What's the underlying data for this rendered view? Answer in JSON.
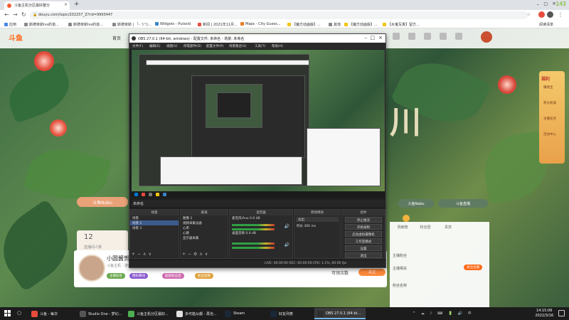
{
  "browser": {
    "tab_title": "斗鱼主机分区最好整分",
    "fps_overlay": "143",
    "url": "douyu.com/topic/202257_Z?rid=9993447",
    "bookmarks": [
      "应用",
      "斯德亲斯lvs的道...",
      "斯德亲斯lvs的道...",
      "斯德亲斯 | 「- ツつ...",
      "Widgets - Pulsoid",
      "新闻 | 2021年11月...",
      "Maps - City Guess...",
      "【魔方动画版】...",
      "其他",
      "【魔方动画版】...",
      "【水鬼写真】留方..."
    ],
    "reading_list": "阅读清单"
  },
  "douyu": {
    "logo": "斗鱼",
    "home": "首页",
    "big_title": "川",
    "left_button": "斗鱼Nabu",
    "stat_num": "12",
    "stat_label": "直播间人数",
    "streamer": {
      "name": "小圆酱贺",
      "meta": "斗鱼主机 · 游戏主播",
      "pills": [
        "主播标签",
        "精彩瞬间",
        "超级粉丝团",
        "粉丝勋章"
      ],
      "follow_count": "可领次数",
      "follow_btn": "关注"
    },
    "right_pills": [
      "斗鱼Nabu",
      "斗鱼直播"
    ],
    "right_sidebar": {
      "tabs": [
        "贡献榜",
        "粉丝团",
        "贵宾"
      ],
      "rows": [
        "主播粉丝",
        "主播相关"
      ],
      "badges": [
        "关注主播"
      ],
      "list_item": "粉丝名称"
    },
    "promo": {
      "title": "福利",
      "items": [
        "赚钱宝",
        "积分商城",
        "主播任务",
        "活动中心"
      ]
    }
  },
  "obs": {
    "title": "OBS 27.0.1 (64-bit, windows) - 配置文件: 未命名 - 场景: 未命名",
    "menu": [
      "文件(F)",
      "编辑(E)",
      "视图(V)",
      "停靠部件(D)",
      "配置文件(P)",
      "场景集合(S)",
      "工具(T)",
      "帮助(H)"
    ],
    "scene_label": "未命名",
    "docks": {
      "scenes": {
        "title": "场景",
        "items": [
          "场景",
          "场景 2",
          "场景 3"
        ]
      },
      "sources": {
        "title": "来源",
        "items": [
          "图像 2",
          "视频采集设备",
          "心率",
          "心跳",
          "显示器采集"
        ]
      },
      "mixer": {
        "title": "混音器",
        "items": [
          "麦克风/Aux",
          "桌面音频"
        ],
        "levels": [
          "0.0 dB",
          "0.0 dB"
        ]
      },
      "transitions": {
        "title": "转场特效",
        "items": [
          "淡出",
          "时长",
          "300 ms"
        ]
      },
      "controls": {
        "title": "控件",
        "items": [
          "停止推流",
          "开始录制",
          "启动虚拟摄像机",
          "工作室模式",
          "设置",
          "退出"
        ]
      }
    },
    "status": "LIVE: 00:00:00   REC: 00:00:00   CPU: 1.1%, 60.00 fps"
  },
  "taskbar": {
    "tasks": [
      "斗鱼 - 每次",
      "Studio One - 梦幻...",
      "斗鱼主机分区最好...",
      "多可能从都 - 再也...",
      "Steam",
      "好友列表",
      "OBS 27.0.1 (64-bi..."
    ],
    "time": "14:15:06",
    "date": "2022/3/16"
  },
  "colors": {
    "douyu_orange": "#ff6a1a",
    "obs_dark": "#1f1f1f",
    "taskbar": "#1c1c1c"
  }
}
